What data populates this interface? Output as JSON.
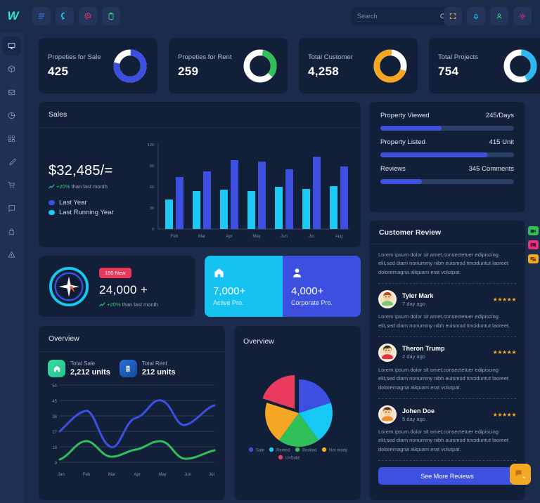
{
  "brand": {
    "logo_text": "W"
  },
  "topbar": {
    "icons": [
      "menu-icon",
      "chat-icon",
      "mention-icon",
      "clipboard-icon"
    ],
    "search": {
      "placeholder": "Search",
      "value": ""
    },
    "right_icons": [
      "fullscreen-icon",
      "bell-icon",
      "user-icon",
      "gear-icon"
    ]
  },
  "sidebar": {
    "items": [
      {
        "icon": "monitor-icon",
        "active": true
      },
      {
        "icon": "package-icon",
        "active": false
      },
      {
        "icon": "inbox-icon",
        "active": false
      },
      {
        "icon": "pie-chart-icon",
        "active": false
      },
      {
        "icon": "grid-apps-icon",
        "active": false
      },
      {
        "icon": "edit-icon",
        "active": false
      },
      {
        "icon": "cart-icon",
        "active": false
      },
      {
        "icon": "message-icon",
        "active": false
      },
      {
        "icon": "lock-icon",
        "active": false
      },
      {
        "icon": "alert-icon",
        "active": false
      }
    ]
  },
  "stats": [
    {
      "label": "Propeties for Sale",
      "value": "425",
      "color": "#3c4fe0",
      "track": "#ffffff",
      "percent": 78
    },
    {
      "label": "Propeties for Rent",
      "value": "259",
      "color": "#2fc05a",
      "track": "#ffffff",
      "percent": 34
    },
    {
      "label": "Total Customer",
      "value": "4,258",
      "color": "#f5a623",
      "track": "#ffffff",
      "percent": 72
    },
    {
      "label": "Total Projects",
      "value": "754",
      "color": "#2cb8ef",
      "track": "#ffffff",
      "percent": 42
    }
  ],
  "sales": {
    "title": "Sales",
    "amount": "$32,485/=",
    "delta_value": "+20%",
    "delta_text": "than last month",
    "legend": [
      {
        "label": "Last Year",
        "color": "#3c4fe0"
      },
      {
        "label": "Last Running Year",
        "color": "#1ec8f5"
      }
    ]
  },
  "progress": [
    {
      "label": "Property Viewed",
      "value": "245/Days",
      "percent": 46
    },
    {
      "label": "Property Listed",
      "value": "415 Unit",
      "percent": 80
    },
    {
      "label": "Reviews",
      "value": "345 Comments",
      "percent": 31
    }
  ],
  "compass": {
    "badge": "180 New",
    "value": "24,000 +",
    "delta_value": "+20%",
    "delta_text": "than last month"
  },
  "pro": [
    {
      "value": "7,000+",
      "label": "Active Pro.",
      "bg": "#14c3f2",
      "icon": "home-icon"
    },
    {
      "value": "4,000+",
      "label": "Corporate Pro.",
      "bg": "#3c4fe0",
      "icon": "person-icon"
    }
  ],
  "overview_line": {
    "title": "Overview",
    "stats": [
      {
        "label": "Total Sale",
        "value": "2,212 units",
        "icon": "home-icon"
      },
      {
        "label": "Total Rent",
        "value": "212 units",
        "icon": "building-icon"
      }
    ]
  },
  "overview_pie": {
    "title": "Overview"
  },
  "reviews": {
    "title": "Customer Review",
    "intro": "Lorem ipsum dolor sit amet,consectetuer edipiscing elit,sed diam nonummy nibh euismod tinciduntut laoreet doloremagna aliquam erat volutpat.",
    "items": [
      {
        "name": "Tyler Mark",
        "time": "7 day ago",
        "stars": "★★★★★",
        "text": "Lorem ipsum dolor sit amet,consectetuer edipiscing elit,sed diam nonummy nibh euismod tinciduntut laoreet."
      },
      {
        "name": "Theron Trump",
        "time": "2 day ago",
        "stars": "★★★★★",
        "text": "Lorem ipsum dolor sit amet,consectetuer edipiscing elit,sed diam nonummy nibh euismod tinciduntut laoreet doloremagna aliquam erat volutpat."
      },
      {
        "name": "Johen Doe",
        "time": "5 day ago",
        "stars": "★★★★★",
        "text": "Lorem ipsum dolor sit amet,consectetuer edipiscing elit,sed diam nonummy nibh euismod tinciduntut laoreet doloremagna aliquam erat volutpat."
      }
    ],
    "see_more_label": "See More Reviews"
  },
  "floating": {
    "icons": [
      "video-icon",
      "image-icon",
      "chat-bubble-icon"
    ],
    "fab": "chat-fab-icon"
  },
  "chart_data": [
    {
      "type": "bar",
      "title": "Sales",
      "categories": [
        "Feb",
        "Mar",
        "Apr",
        "May",
        "Jun",
        "Jul",
        "Aug"
      ],
      "series": [
        {
          "name": "Last Running Year",
          "color": "#1ec8f5",
          "values": [
            42,
            54,
            56,
            54,
            60,
            57,
            61
          ]
        },
        {
          "name": "Last Year",
          "color": "#3c4fe0",
          "values": [
            74,
            82,
            98,
            96,
            85,
            103,
            89
          ]
        }
      ],
      "yticks": [
        0,
        30,
        60,
        90,
        120
      ],
      "ylim": [
        0,
        120
      ],
      "xlabel": "",
      "ylabel": "",
      "grid": false,
      "legend": "left"
    },
    {
      "type": "line",
      "title": "Overview",
      "x": [
        "Jan",
        "Feb",
        "Mar",
        "Apr",
        "May",
        "Jun",
        "Jul"
      ],
      "series": [
        {
          "name": "Total Sale",
          "color": "#3c4fe0",
          "values": [
            27,
            39,
            22,
            35,
            45,
            32,
            43
          ]
        },
        {
          "name": "Total Rent",
          "color": "#2fc05a",
          "values": [
            11,
            21,
            14,
            17,
            21,
            12,
            17
          ]
        }
      ],
      "yticks": [
        9,
        18,
        27,
        36,
        45,
        54
      ],
      "ylim": [
        5,
        54
      ],
      "grid": true,
      "legend": "none"
    },
    {
      "type": "pie",
      "title": "Overview",
      "labels": [
        "Sale",
        "Rented",
        "Booked",
        "Not ready",
        "UnSold"
      ],
      "colors": [
        "#3c4fe0",
        "#17c8f5",
        "#2fc05a",
        "#f5a623",
        "#ea3a5e"
      ],
      "values": [
        18,
        20,
        20,
        20,
        22
      ],
      "exploded": [
        "UnSold"
      ],
      "legend": "bottom"
    }
  ]
}
